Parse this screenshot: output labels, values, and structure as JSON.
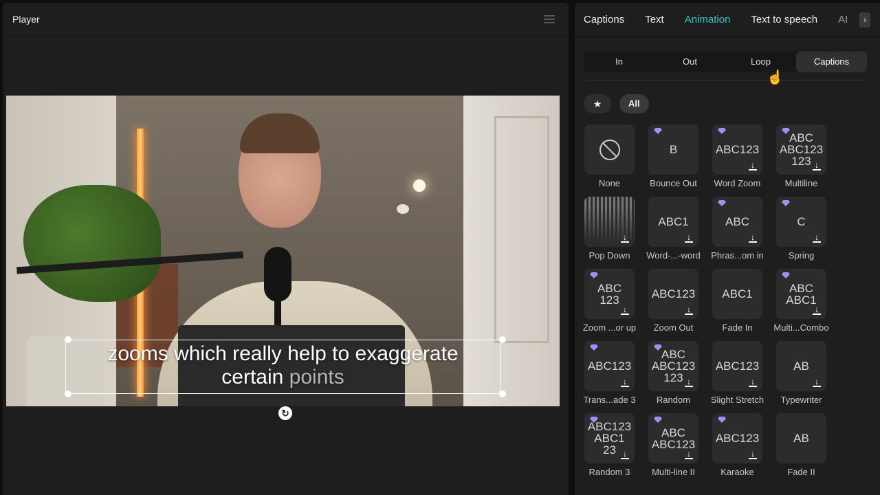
{
  "player": {
    "title": "Player"
  },
  "caption": {
    "line1": "zooms which really help to exaggerate",
    "line2_main": "certain",
    "line2_dim": "points"
  },
  "panel": {
    "tabs": [
      {
        "label": "Captions",
        "active": false
      },
      {
        "label": "Text",
        "active": false
      },
      {
        "label": "Animation",
        "active": true
      },
      {
        "label": "Text to speech",
        "active": false
      },
      {
        "label": "AI",
        "active": false
      }
    ],
    "segments": [
      "In",
      "Out",
      "Loop",
      "Captions"
    ],
    "active_segment": "Captions",
    "filters": {
      "favorites_icon": "star-icon",
      "all_label": "All"
    },
    "accent_color": "#34c6c6",
    "items": [
      {
        "label": "None",
        "preview": "",
        "premium": false,
        "download": false
      },
      {
        "label": "Bounce Out",
        "preview": "B",
        "premium": true,
        "download": false
      },
      {
        "label": "Word Zoom",
        "preview": "ABC123",
        "premium": true,
        "download": true
      },
      {
        "label": "Multiline",
        "preview": "ABC\nABC123\n123",
        "premium": true,
        "download": true
      },
      {
        "label": "Pop Down",
        "preview": "",
        "premium": false,
        "download": true
      },
      {
        "label": "Word-...-word",
        "preview": "ABC1",
        "premium": false,
        "download": true
      },
      {
        "label": "Phras...om in",
        "preview": "ABC",
        "premium": true,
        "download": true
      },
      {
        "label": "Spring",
        "preview": "C",
        "premium": true,
        "download": true
      },
      {
        "label": "Zoom ...or up",
        "preview": "ABC\n123",
        "premium": true,
        "download": true
      },
      {
        "label": "Zoom Out",
        "preview": "ABC123",
        "premium": false,
        "download": true
      },
      {
        "label": "Fade In",
        "preview": "ABC1",
        "premium": false,
        "download": false
      },
      {
        "label": "Multi...Combo",
        "preview": "ABC\nABC1",
        "premium": true,
        "download": true
      },
      {
        "label": "Trans...ade 3",
        "preview": "ABC123",
        "premium": true,
        "download": true
      },
      {
        "label": "Random",
        "preview": "ABC\nABC123\n123",
        "premium": true,
        "download": true
      },
      {
        "label": "Slight Stretch",
        "preview": "ABC123",
        "premium": false,
        "download": true
      },
      {
        "label": "Typewriter",
        "preview": "AB",
        "premium": false,
        "download": true
      },
      {
        "label": "Random 3",
        "preview": "ABC123\nABC1\n23",
        "premium": true,
        "download": true
      },
      {
        "label": "Multi-line II",
        "preview": "ABC\nABC123",
        "premium": true,
        "download": true
      },
      {
        "label": "Karaoke",
        "preview": "ABC123",
        "premium": true,
        "download": true
      },
      {
        "label": "Fade  II",
        "preview": "AB",
        "premium": false,
        "download": false
      }
    ]
  }
}
